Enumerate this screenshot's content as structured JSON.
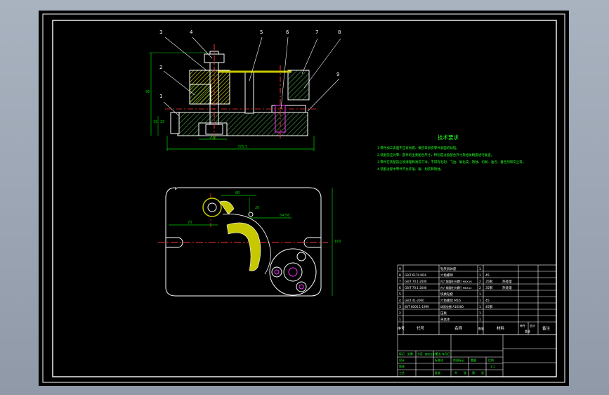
{
  "colors": {
    "background": "#000000",
    "outer_frame": "#a9b3c0",
    "line_white": "#ffffff",
    "hatch_green": "#3b7d3b",
    "part_yellow": "#c8c800",
    "dimension_green": "#00d000",
    "centerline_red": "#ff3030",
    "accent_magenta": "#ff30ff",
    "text_green": "#22ff22"
  },
  "balloons": [
    "3",
    "4",
    "2",
    "1",
    "5",
    "6",
    "7",
    "8",
    "9"
  ],
  "front_view": {
    "dims": {
      "overall_width": "370.5",
      "bottom_width": "200",
      "height_left": "96",
      "base_h1": "15",
      "base_h2": "25"
    }
  },
  "top_view": {
    "dims": {
      "width_top": "80",
      "h_small": "20",
      "offset_left": "70",
      "r_value": "54.56",
      "height_right": "160"
    }
  },
  "tech_requirements": {
    "title": "技术要求",
    "lines": [
      "1.零件加工表面不应有划痕、擦伤等损伤零件表面的缺陷。",
      "2.装配前应对零、部件的主要配合尺寸，特别是过盈配合尺寸及相关精度进行复查。",
      "3.零件在装配前必须清理和清洗干净，不得有毛刺、飞边、氧化皮、锈蚀、切屑、油污、着色剂和灰尘等。",
      "4.装配过程中零件不允许磕、碰、划伤和锈蚀。"
    ]
  },
  "bom": {
    "rows": [
      {
        "no": "9",
        "code": "",
        "name": "钻夹具体座",
        "qty": "1",
        "material": "",
        "note": ""
      },
      {
        "no": "8",
        "code": "GB/T 6170 M16",
        "name": "六角螺母",
        "qty": "1",
        "material": "45",
        "note": ""
      },
      {
        "no": "7",
        "code": "GB/T 70.1-2000",
        "name": "内六角圆柱头螺钉 M8X16",
        "qty": "2",
        "material": "35钢",
        "note": "热处理"
      },
      {
        "no": "6",
        "code": "GB/T 70.1-2000",
        "name": "内六角圆柱头螺钉 M6X12",
        "qty": "2",
        "material": "35钢",
        "note": "热处理"
      },
      {
        "no": "5",
        "code": "",
        "name": "快换钻套",
        "qty": "1",
        "material": "",
        "note": ""
      },
      {
        "no": "4",
        "code": "GB/T 41-2000",
        "name": "六角螺母 M16",
        "qty": "1",
        "material": "45",
        "note": ""
      },
      {
        "no": "3",
        "code": "JB/T 8006.1-1999",
        "name": "球面垫圈 A16X80",
        "qty": "1",
        "material": "45钢",
        "note": ""
      },
      {
        "no": "2",
        "code": "",
        "name": "压板",
        "qty": "1",
        "material": "",
        "note": ""
      },
      {
        "no": "1",
        "code": "",
        "name": "夹具体",
        "qty": "1",
        "material": "",
        "note": ""
      }
    ],
    "headers": {
      "no": "序号",
      "code": "代号",
      "name": "名称",
      "qty": "数量",
      "material": "材料",
      "single": "单件",
      "total": "总计",
      "weight": "重量",
      "note": "备注"
    }
  },
  "title_block": {
    "labels": [
      "标记",
      "处数",
      "分区",
      "更改文件号",
      "签名",
      "年月日",
      "设计",
      "标准化",
      "阶段标记",
      "重量",
      "比例",
      "审核",
      "工艺",
      "批准",
      "共",
      "张",
      "第",
      "张"
    ],
    "scale": "1:1"
  }
}
